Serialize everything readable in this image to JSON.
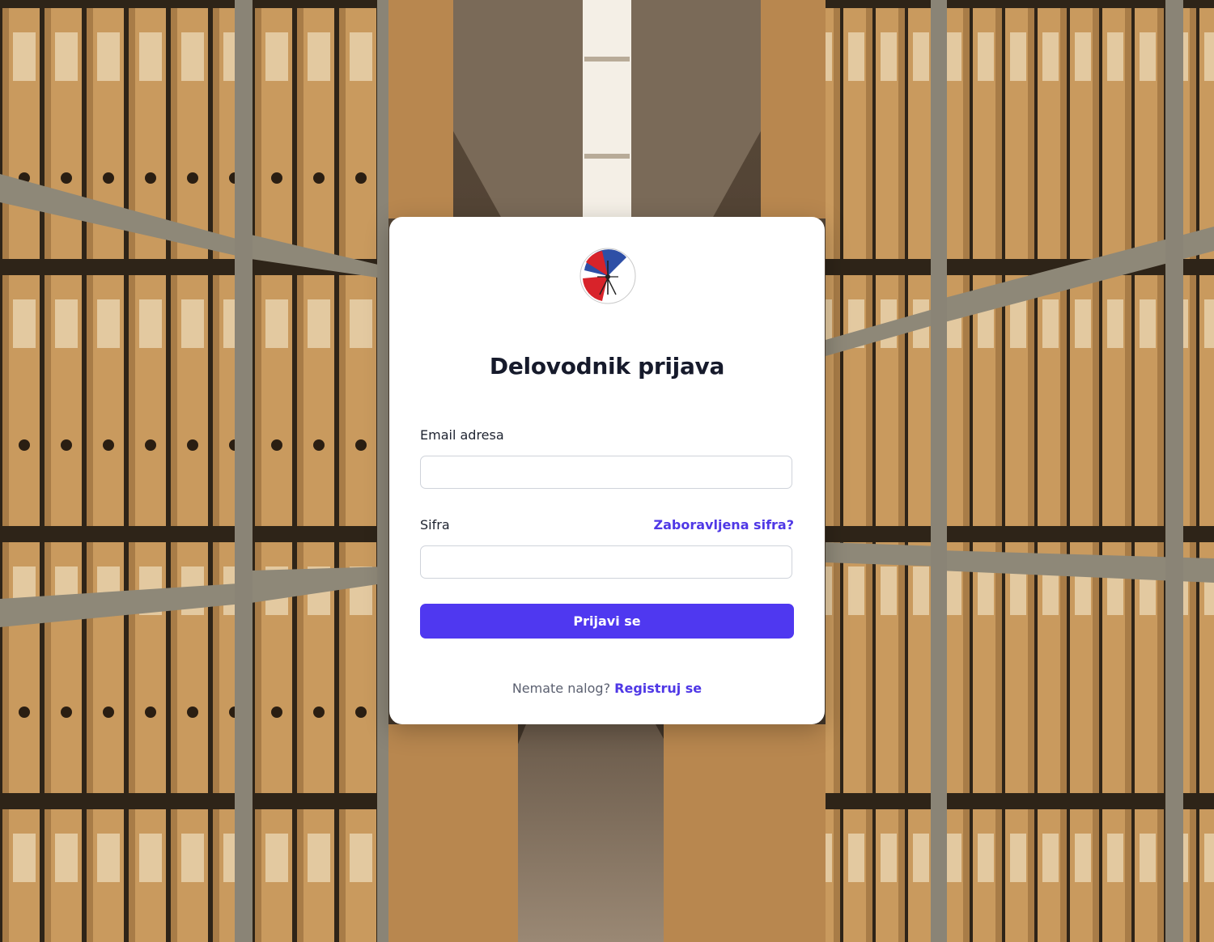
{
  "background": {
    "description_icon": "archive-shelves-photo"
  },
  "card": {
    "title": "Delovodnik prijava",
    "email_label": "Email adresa",
    "email_value": "",
    "email_placeholder": "",
    "password_label": "Sifra",
    "password_value": "",
    "password_placeholder": "",
    "forgot_link": "Zaboravljena sifra?",
    "submit_label": "Prijavi se",
    "footer_text": "Nemate nalog?",
    "register_link": "Registruj se"
  },
  "colors": {
    "accent": "#4f38f0",
    "link": "#4f38e6",
    "title": "#161a2b",
    "card_bg": "#ffffff"
  }
}
